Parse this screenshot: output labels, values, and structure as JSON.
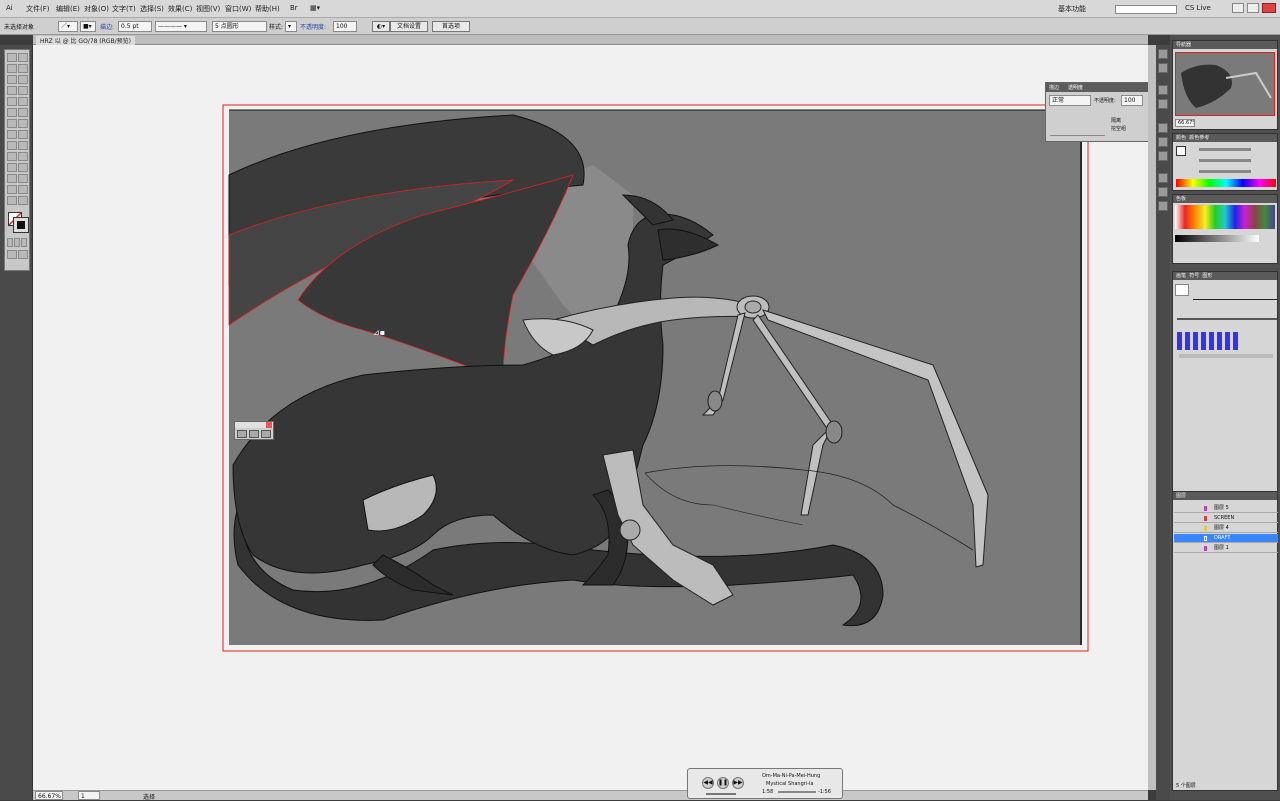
{
  "window": {
    "document_tab": "HRZ 以 @ 比 GO/78 (RGB/预览)",
    "zoom": "66.67%",
    "page": "1",
    "status": "选择"
  },
  "menu": {
    "items": [
      "文件(F)",
      "编辑(E)",
      "对象(O)",
      "文字(T)",
      "选择(S)",
      "效果(C)",
      "视图(V)",
      "窗口(W)",
      "帮助(H)"
    ],
    "workspace": "基本功能",
    "search_placeholder": "",
    "cs_live": "CS Live"
  },
  "control": {
    "selection_label": "未选择对象",
    "stroke_label": "描边:",
    "stroke_weight": "0.5 pt",
    "brush": "5 点圆形",
    "opacity_label": "不透明度:",
    "opacity_value": "100",
    "doc_setup": "文档设置",
    "preferences": "首选项"
  },
  "floating_panel": {
    "tab1": "描边",
    "tab2": "透明度",
    "mode": "正常",
    "opacity_label": "不透明度:",
    "opacity_value": "100",
    "opt1": "隔离",
    "opt2": "挖空组"
  },
  "panels": {
    "navigator_tab": "导航器",
    "zoom": "66.67%",
    "color_tab": "颜色",
    "color_guide_tab": "颜色参考",
    "swatches_tab": "色板",
    "brushes_tabs": [
      "画笔",
      "符号",
      "图形"
    ],
    "layers_tab": "图层",
    "layers": [
      {
        "name": "图层 5",
        "color": "#c040c0",
        "selected": false
      },
      {
        "name": "SCREEN",
        "color": "#cc4444",
        "selected": false
      },
      {
        "name": "图层 4",
        "color": "#d8d040",
        "selected": false
      },
      {
        "name": "DRAFT",
        "color": "#4080ff",
        "selected": true
      },
      {
        "name": "图层 1",
        "color": "#c040c0",
        "selected": false
      }
    ],
    "layers_count": "5 个图层"
  },
  "player": {
    "title": "Om-Ma-Ni-Pa-Mei-Hung",
    "artist": "Mystical Shangri-la",
    "elapsed": "1:58",
    "remaining": "-1:56"
  },
  "colors": {
    "artboard_bg": "#7a7a7a",
    "dragon_dark": "#363636",
    "dragon_light": "#b8b8b8",
    "selection_red": "#e02020"
  }
}
